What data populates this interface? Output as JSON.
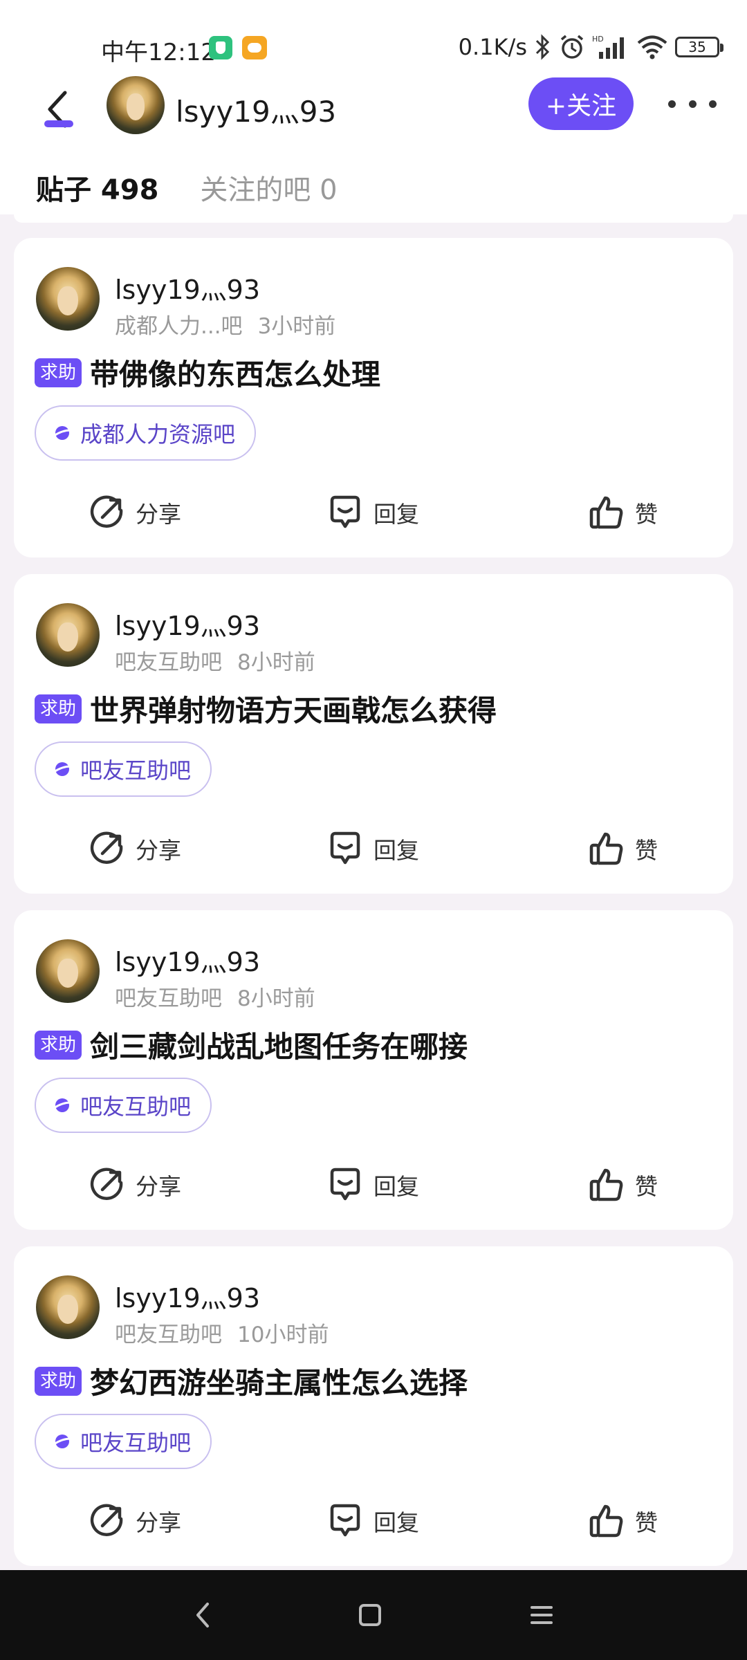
{
  "status_bar": {
    "time": "中午12:12",
    "network_speed": "0.1K/s",
    "battery": "35",
    "icons": [
      "security-app-icon",
      "weather-app-icon",
      "bluetooth-icon",
      "alarm-icon",
      "hd-signal-icon",
      "wifi-icon",
      "battery-icon"
    ]
  },
  "header": {
    "username": "lsyy19灬93",
    "follow_label": "+关注",
    "icons": [
      "back-icon",
      "more-icon"
    ]
  },
  "tabs": [
    {
      "label": "贴子 498",
      "active": true
    },
    {
      "label": "关注的吧 0",
      "active": false
    }
  ],
  "colors": {
    "accent": "#6c4ef5",
    "background": "#f5f1f6",
    "card": "#ffffff",
    "meta_text": "#9a9a9a"
  },
  "posts": [
    {
      "author": "lsyy19灬93",
      "forum": "成都人力...吧",
      "time": "3小时前",
      "tag": "求助",
      "title": "带佛像的东西怎么处理",
      "chip": "成都人力资源吧",
      "share": "分享",
      "reply": "回复",
      "like": "赞"
    },
    {
      "author": "lsyy19灬93",
      "forum": "吧友互助吧",
      "time": "8小时前",
      "tag": "求助",
      "title": "世界弹射物语方天画戟怎么获得",
      "chip": "吧友互助吧",
      "share": "分享",
      "reply": "回复",
      "like": "赞"
    },
    {
      "author": "lsyy19灬93",
      "forum": "吧友互助吧",
      "time": "8小时前",
      "tag": "求助",
      "title": "剑三藏剑战乱地图任务在哪接",
      "chip": "吧友互助吧",
      "share": "分享",
      "reply": "回复",
      "like": "赞"
    },
    {
      "author": "lsyy19灬93",
      "forum": "吧友互助吧",
      "time": "10小时前",
      "tag": "求助",
      "title": "梦幻西游坐骑主属性怎么选择",
      "chip": "吧友互助吧",
      "share": "分享",
      "reply": "回复",
      "like": "赞"
    }
  ]
}
